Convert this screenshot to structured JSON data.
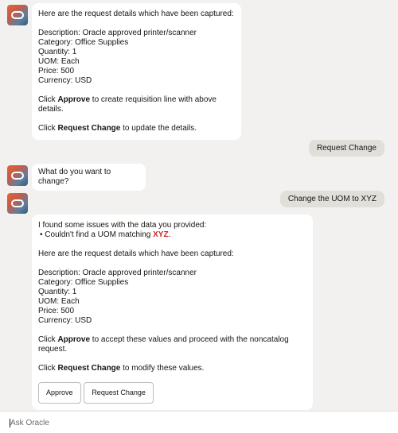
{
  "bot_messages": [
    {
      "intro": "Here are the request details which have been captured:",
      "details": [
        "Description: Oracle approved printer/scanner",
        "Category: Office Supplies",
        "Quantity: 1",
        "UOM: Each",
        "Price: 500",
        "Currency: USD"
      ],
      "approve_pre": "Click ",
      "approve_word": "Approve",
      "approve_post": " to create requisition line with above details.",
      "change_pre": "Click ",
      "change_word": "Request Change",
      "change_post": " to update the details."
    },
    {
      "text": "What do you want to change?"
    },
    {
      "issue_intro": "I found some issues with the data you provided:",
      "issue_bullet_pre": "• Couldn't find a UOM matching ",
      "issue_bullet_value": "XYZ",
      "issue_bullet_post": ".",
      "intro": "Here are the request details which have been captured:",
      "details": [
        "Description: Oracle approved printer/scanner",
        "Category: Office Supplies",
        "Quantity: 1",
        "UOM: Each",
        "Price: 500",
        "Currency: USD"
      ],
      "approve_pre": "Click ",
      "approve_word": "Approve",
      "approve_post": " to accept these values and proceed with the noncatalog request.",
      "change_pre": "Click ",
      "change_word": "Request Change",
      "change_post": " to modify these values.",
      "buttons": {
        "approve": "Approve",
        "request_change": "Request Change"
      }
    }
  ],
  "user_messages": [
    "Request Change",
    "Change the UOM to XYZ"
  ],
  "composer": {
    "placeholder": "Ask Oracle"
  },
  "colors": {
    "error": "#d21f1f",
    "background": "#f2f1ef",
    "user_bubble": "#e1dfd9"
  },
  "icons": {
    "bot_avatar": "oracle-logo-icon"
  }
}
